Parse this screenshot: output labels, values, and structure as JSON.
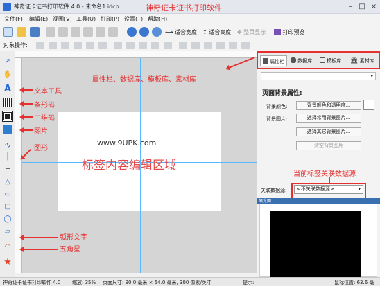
{
  "window": {
    "title": "神奇证卡证书打印软件 4.0 - 未命名1.idcp",
    "overlay_title": "神奇证卡证书打印软件"
  },
  "menu": [
    "文件(F)",
    "编辑(E)",
    "视图(V)",
    "工具(U)",
    "打印(P)",
    "设置(T)",
    "帮助(H)"
  ],
  "toolbar": {
    "fit_width": "适合宽度",
    "fit_height": "适合高度",
    "hide_page": "整页显示",
    "print_preview": "打印预览"
  },
  "alignbar": {
    "label": "对象操作:"
  },
  "canvas": {
    "edit_label": "标签内容编辑区域",
    "watermark": "www.9UPK.com"
  },
  "annotations": {
    "text_tool": "文本工具",
    "barcode": "条形码",
    "qrcode": "二维码",
    "image": "图片",
    "shapes": "图形",
    "arc_text": "弧形文字",
    "star": "五角星",
    "panels": "属性栏、数据库、模板库、素材库",
    "datasource": "当前标签关联数据源"
  },
  "panel": {
    "tabs": [
      "属性栏",
      "数据库",
      "模板库",
      "素材库"
    ],
    "section_title": "页面背景属性:",
    "bg_color_label": "背景颜色:",
    "bg_color_btn": "背景颜色和透明度...",
    "bg_image_label": "背景图片:",
    "bg_image_btn1": "选择常用背景图片...",
    "bg_image_btn2": "选择其它背景图片...",
    "clear_bg_btn": "清空背景图片",
    "assoc_label": "关联数据源:",
    "assoc_value": "<不关联数据源>",
    "preview_title": "缩览图"
  },
  "status": {
    "app": "神奇证卡证书打印软件 4.0",
    "zoom": "缩放: 35%",
    "page_size": "页面尺寸: 90.0 毫米 × 54.0 毫米, 300 像素/英寸",
    "hint": "提示:",
    "cursor": "鼠标位置: 63.6 毫"
  },
  "colors": {
    "annotation": "#e53030",
    "guide": "#5ab8ff"
  }
}
